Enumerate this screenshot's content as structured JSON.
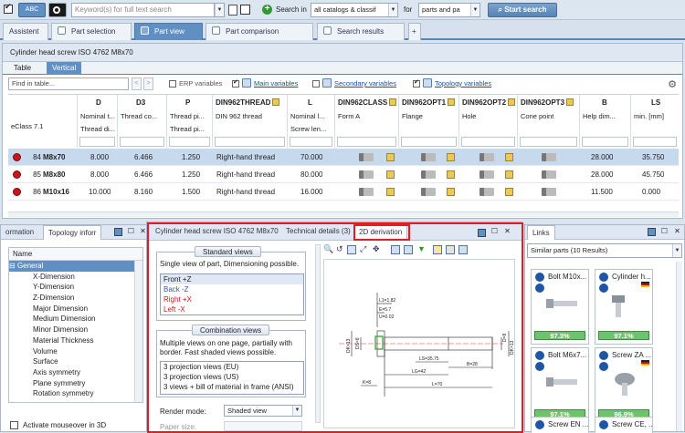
{
  "search": {
    "abc_label": "ABC",
    "keyword_placeholder": "Keyword(s) for full text search",
    "search_in_label": "Search in",
    "search_in_value": "all catalogs & classif",
    "for_label": "for",
    "for_value": "parts and pa",
    "start_label": "Start search"
  },
  "main_tabs": [
    {
      "label": "Assistent"
    },
    {
      "label": "Part selection"
    },
    {
      "label": "Part view"
    },
    {
      "label": "Part comparison"
    },
    {
      "label": "Search results"
    },
    {
      "label": "+"
    }
  ],
  "part": {
    "title": "Cylinder head screw ISO 4762 M8x70",
    "view_tabs": [
      "Table",
      "Vertical"
    ],
    "find_placeholder": "Find in table...",
    "nav_prev": "<",
    "nav_next": ">",
    "erp_label": "ERP variables",
    "main_vars": "Main variables",
    "secondary_vars": "Secondary variables",
    "topology_vars": "Topology variables",
    "eclass": "eClass 7.1",
    "columns": [
      {
        "code": "D",
        "l2": "Nominal t...",
        "l3": "Thread di..."
      },
      {
        "code": "D3",
        "l2": "Thread co...",
        "l3": ""
      },
      {
        "code": "P",
        "l2": "Thread pi...",
        "l3": "Thread pi..."
      },
      {
        "code": "DIN962THREAD",
        "l2": "DIN 962 thread",
        "l3": ""
      },
      {
        "code": "L",
        "l2": "Nominal l...",
        "l3": "Screw len..."
      },
      {
        "code": "DIN962CLASS",
        "l2": "Form A",
        "l3": ""
      },
      {
        "code": "DIN962OPT1",
        "l2": "Flange",
        "l3": ""
      },
      {
        "code": "DIN962OPT2",
        "l2": "Hole",
        "l3": ""
      },
      {
        "code": "DIN962OPT3",
        "l2": "Cone point",
        "l3": ""
      },
      {
        "code": "B",
        "l2": "Help dim...",
        "l3": ""
      },
      {
        "code": "LS",
        "l2": "min. [mm]",
        "l3": ""
      }
    ],
    "rows": [
      {
        "num": "84",
        "name": "M8x70",
        "d": "8.000",
        "d3": "6.466",
        "p": "1.250",
        "thread": "Right-hand thread",
        "l": "70.000",
        "b": "28.000",
        "ls": "35.750"
      },
      {
        "num": "85",
        "name": "M8x80",
        "d": "8.000",
        "d3": "6.466",
        "p": "1.250",
        "thread": "Right-hand thread",
        "l": "80.000",
        "b": "28.000",
        "ls": "45.750"
      },
      {
        "num": "86",
        "name": "M10x16",
        "d": "10.000",
        "d3": "8.160",
        "p": "1.500",
        "thread": "Right-hand thread",
        "l": "16.000",
        "b": "11.500",
        "ls": "0.000"
      }
    ]
  },
  "left_panel": {
    "tabs": [
      "ormation",
      "Topology inforr"
    ],
    "tree_header": "Name",
    "group": "General",
    "items": [
      "X-Dimension",
      "Y-Dimension",
      "Z-Dimension",
      "Major Dimension",
      "Medium Dimension",
      "Minor Dimension",
      "Material Thickness",
      "Volume",
      "Surface",
      "Axis symmetry",
      "Plane symmetry",
      "Rotation symmetry"
    ],
    "mouseover_label": "Activate mouseover in 3D"
  },
  "center_panel": {
    "tabs": [
      "Cylinder head screw ISO 4762 M8x70",
      "Technical details (3)",
      "2D derivation"
    ],
    "standard_title": "Standard views",
    "standard_desc": "Single view of part, Dimensioning possible.",
    "standard_views": [
      {
        "label": "Front +Z",
        "color": "#222222"
      },
      {
        "label": "Back -Z",
        "color": "#3a4fd1"
      },
      {
        "label": "Right +X",
        "color": "#d3141b"
      },
      {
        "label": "Left -X",
        "color": "#d3141b"
      }
    ],
    "combination_title": "Combination views",
    "combination_desc": "Multiple views on one page, partially with border. Fast shaded views possible.",
    "combination_views": [
      "3 projection views (EU)",
      "3 projection views (US)",
      "3 views + bill of material in frame (ANSI)"
    ],
    "render_label": "Render mode:",
    "render_value": "Shaded view",
    "paper_label": "Paper size:",
    "dims": {
      "l_label": "L=70",
      "ls_label": "LS=35.75",
      "lg_label": "LG=42",
      "b_label": "B=28",
      "k_label": "K=8",
      "d_label": "D=8",
      "dk_label": "DK=13",
      "ds_label": "DS=8",
      "l1_label": "L1=1.82",
      "e_label": "E=5.7",
      "u_label": "U=0.02"
    }
  },
  "right_panel": {
    "title": "Links",
    "dropdown": "Similar parts (10 Results)",
    "cards": [
      {
        "title": "Bolt M10x...",
        "pct": "97.3%"
      },
      {
        "title": "Cylinder h...",
        "pct": "97.1%"
      },
      {
        "title": "Bolt M6x7...",
        "pct": "97.1%"
      },
      {
        "title": "Screw ZA ...",
        "pct": "96.9%"
      },
      {
        "title": "Screw EN ...",
        "pct": ""
      },
      {
        "title": "Screw CE, ...",
        "pct": ""
      }
    ]
  },
  "colors": {
    "accent": "#5f8fc3",
    "highlight": "#e31b23",
    "match": "#6dc36d"
  }
}
